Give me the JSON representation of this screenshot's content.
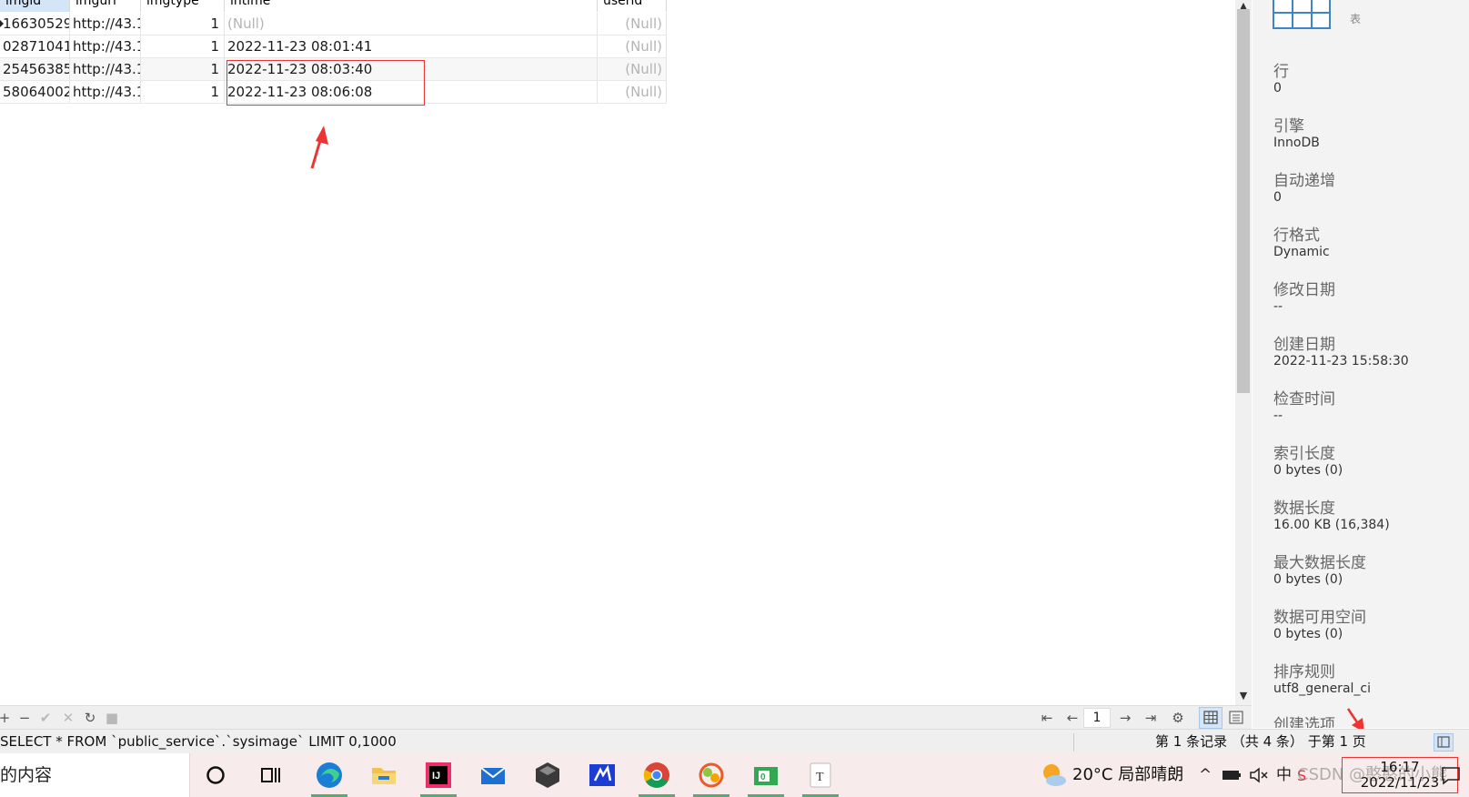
{
  "grid": {
    "columns": [
      "imgid",
      "imgurl",
      "imgtype",
      "intime",
      "userid"
    ],
    "rows": [
      {
        "imgid": "16630529",
        "imgurl": "http://43.1",
        "imgtype": "1",
        "intime": "(Null)",
        "userid": "(Null)"
      },
      {
        "imgid": "02871041",
        "imgurl": "http://43.1",
        "imgtype": "1",
        "intime": "2022-11-23 08:01:41",
        "userid": "(Null)"
      },
      {
        "imgid": "25456385",
        "imgurl": "http://43.1",
        "imgtype": "1",
        "intime": "2022-11-23 08:03:40",
        "userid": "(Null)"
      },
      {
        "imgid": "58064002",
        "imgurl": "http://43.1",
        "imgtype": "1",
        "intime": "2022-11-23 08:06:08",
        "userid": "(Null)"
      }
    ]
  },
  "panel": {
    "object_type": "表",
    "items": [
      {
        "label": "行",
        "value": "0"
      },
      {
        "label": "引擎",
        "value": "InnoDB"
      },
      {
        "label": "自动递增",
        "value": "0"
      },
      {
        "label": "行格式",
        "value": "Dynamic"
      },
      {
        "label": "修改日期",
        "value": "--"
      },
      {
        "label": "创建日期",
        "value": "2022-11-23 15:58:30"
      },
      {
        "label": "检查时间",
        "value": "--"
      },
      {
        "label": "索引长度",
        "value": "0 bytes (0)"
      },
      {
        "label": "数据长度",
        "value": "16.00 KB (16,384)"
      },
      {
        "label": "最大数据长度",
        "value": "0 bytes (0)"
      },
      {
        "label": "数据可用空间",
        "value": "0 bytes (0)"
      },
      {
        "label": "排序规则",
        "value": "utf8_general_ci"
      },
      {
        "label": "创建选项",
        "value": ""
      }
    ]
  },
  "toolbar": {
    "add": "+",
    "remove": "−",
    "apply": "✔",
    "discard": "✕",
    "refresh": "↻",
    "stop": "■",
    "first": "⇤",
    "prev": "←",
    "page": "1",
    "next": "→",
    "last": "⇥",
    "settings": "⚙"
  },
  "status": {
    "sql": "SELECT * FROM `public_service`.`sysimage` LIMIT 0,1000",
    "records": "第 1 条记录 （共 4 条） 于第 1 页"
  },
  "taskbar": {
    "search_text": "的内容",
    "weather": "20°C  局部晴朗",
    "tray_chevron": "^",
    "tray_ime": "中",
    "clock_time": "16:17",
    "clock_date": "2022/11/23",
    "watermark": "CSDN @憨憨的小熊"
  },
  "colors": {
    "accent": "#d3e5f6",
    "annotation_red": "#e33333",
    "taskbar_bg": "#f7ebec"
  }
}
